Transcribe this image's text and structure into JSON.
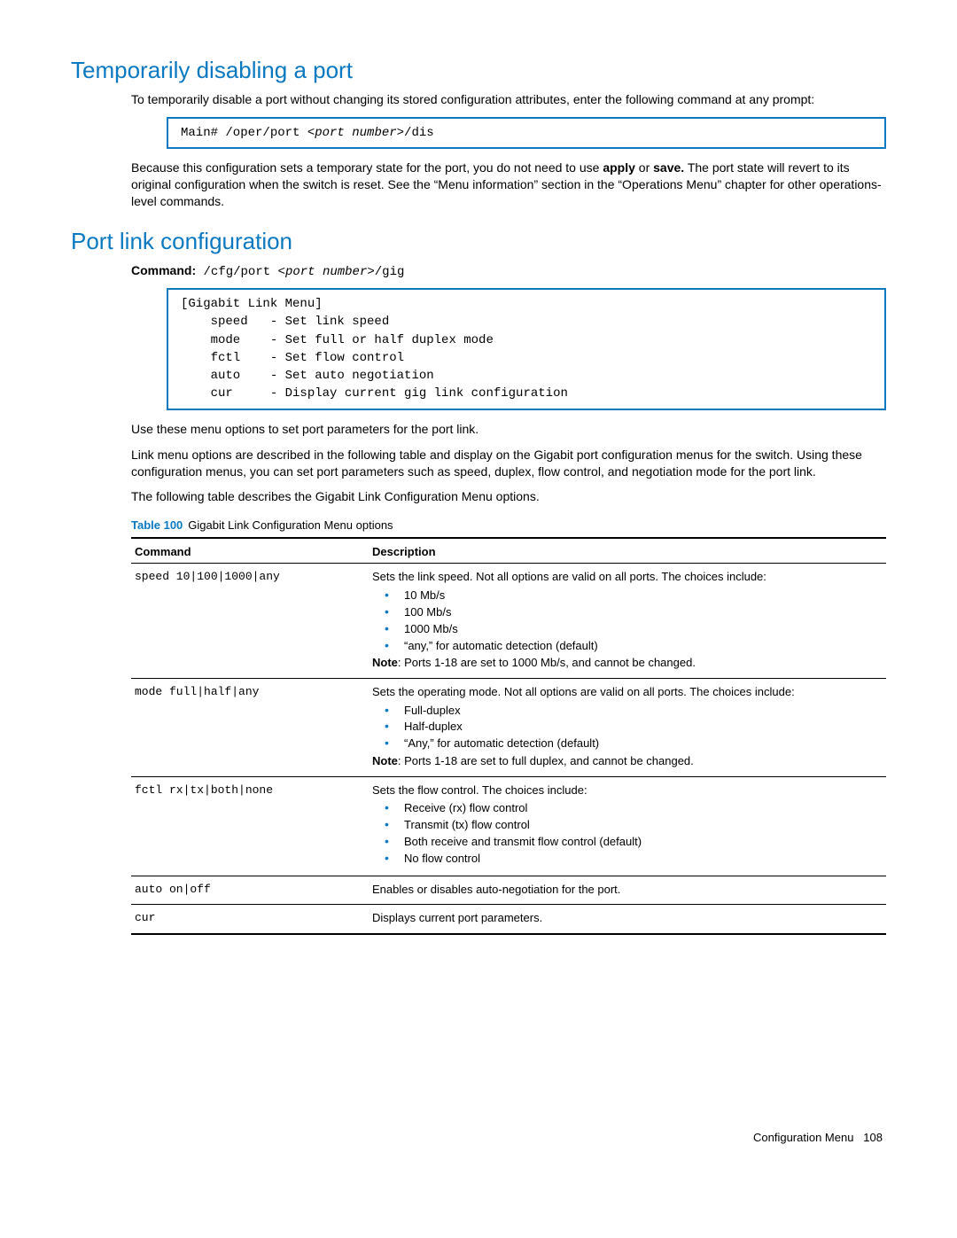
{
  "section1": {
    "heading": "Temporarily disabling a port",
    "intro": "To temporarily disable a port without changing its stored configuration attributes, enter the following command at any prompt:",
    "code_prefix": "Main# /oper/port ",
    "code_var": "<port number>",
    "code_suffix": "/dis",
    "para2_a": "Because this configuration sets a temporary state for the port, you do not need to use ",
    "para2_bold1": "apply",
    "para2_mid": " or ",
    "para2_bold2": "save.",
    "para2_b": " The port state will revert to its original configuration when the switch is reset. See the “Menu information” section in the “Operations Menu” chapter for other operations-level commands."
  },
  "section2": {
    "heading": "Port link configuration",
    "cmd_label": "Command:",
    "cmd_prefix": " /cfg/port ",
    "cmd_var": "<port number>",
    "cmd_suffix": "/gig",
    "menu_box": "[Gigabit Link Menu]\n    speed   - Set link speed\n    mode    - Set full or half duplex mode\n    fctl    - Set flow control\n    auto    - Set auto negotiation\n    cur     - Display current gig link configuration",
    "para1": "Use these menu options to set port parameters for the port link.",
    "para2": "Link menu options are described in the following table and display on the Gigabit port configuration menus for the switch. Using these configuration menus, you can set port parameters such as speed, duplex, flow control, and negotiation mode for the port link.",
    "para3": "The following table describes the Gigabit Link Configuration Menu options.",
    "table_label": "Table 100",
    "table_caption": "Gigabit Link Configuration Menu options",
    "headers": {
      "c1": "Command",
      "c2": "Description"
    },
    "rows": [
      {
        "cmd": "speed 10|100|1000|any",
        "desc_lead": "Sets the link speed. Not all options are valid on all ports. The choices include:",
        "bullets": [
          "10 Mb/s",
          "100 Mb/s",
          "1000 Mb/s",
          "“any,” for automatic detection (default)"
        ],
        "note_label": "Note",
        "note_text": ": Ports 1-18 are set to 1000 Mb/s, and cannot be changed."
      },
      {
        "cmd": "mode full|half|any",
        "desc_lead": "Sets the operating mode. Not all options are valid on all ports. The choices include:",
        "bullets": [
          "Full-duplex",
          "Half-duplex",
          "“Any,” for automatic detection (default)"
        ],
        "note_label": "Note",
        "note_text": ": Ports 1-18 are set to full duplex, and cannot be changed."
      },
      {
        "cmd": "fctl rx|tx|both|none",
        "desc_lead": "Sets the flow control. The choices include:",
        "bullets": [
          "Receive (rx) flow control",
          "Transmit (tx) flow control",
          "Both receive and transmit flow control (default)",
          "No flow control"
        ],
        "note_label": "",
        "note_text": ""
      },
      {
        "cmd": "auto on|off",
        "desc_lead": "Enables or disables auto-negotiation for the port.",
        "bullets": [],
        "note_label": "",
        "note_text": ""
      },
      {
        "cmd": "cur",
        "desc_lead": "Displays current port parameters.",
        "bullets": [],
        "note_label": "",
        "note_text": ""
      }
    ]
  },
  "footer": {
    "section": "Configuration Menu",
    "page": "108"
  }
}
